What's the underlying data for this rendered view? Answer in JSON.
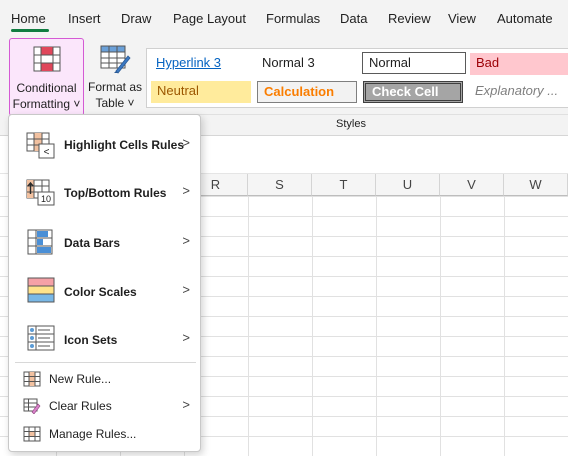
{
  "tabs": [
    "Home",
    "Insert",
    "Draw",
    "Page Layout",
    "Formulas",
    "Data",
    "Review",
    "View",
    "Automate"
  ],
  "ribbon": {
    "conditional_formatting": {
      "line1": "Conditional",
      "line2": "Formatting",
      "chevron": "˅"
    },
    "format_as_table": {
      "line1": "Format as",
      "line2": "Table",
      "chevron": "˅"
    },
    "styles_group_label": "Styles",
    "styles": {
      "hyperlink": "Hyperlink 3",
      "normal3": "Normal 3",
      "normal": "Normal",
      "bad": "Bad",
      "neutral": "Neutral",
      "calculation": "Calculation",
      "check_cell": "Check Cell",
      "explanatory": "Explanatory ..."
    },
    "colors": {
      "bad_bg": "#ffc7ce",
      "bad_fg": "#9c0006",
      "neutral_bg": "#ffeb9c",
      "neutral_fg": "#9c5700",
      "calc_bg": "#f2f2f2",
      "calc_fg": "#fa7d00",
      "check_bg": "#a5a5a5",
      "check_fg": "#ffffff",
      "accent": "#107c41"
    }
  },
  "columns": [
    "R",
    "S",
    "T",
    "U",
    "V",
    "W"
  ],
  "menu": {
    "highlight_cells_rules": "Highlight Cells Rules",
    "top_bottom_rules": "Top/Bottom Rules",
    "data_bars": "Data Bars",
    "color_scales": "Color Scales",
    "icon_sets": "Icon Sets",
    "new_rule": "New Rule...",
    "clear_rules": "Clear Rules",
    "manage_rules": "Manage Rules...",
    "arrow": ">",
    "highlight_icon_symbol": "<",
    "top_bottom_icon_number": "10"
  }
}
